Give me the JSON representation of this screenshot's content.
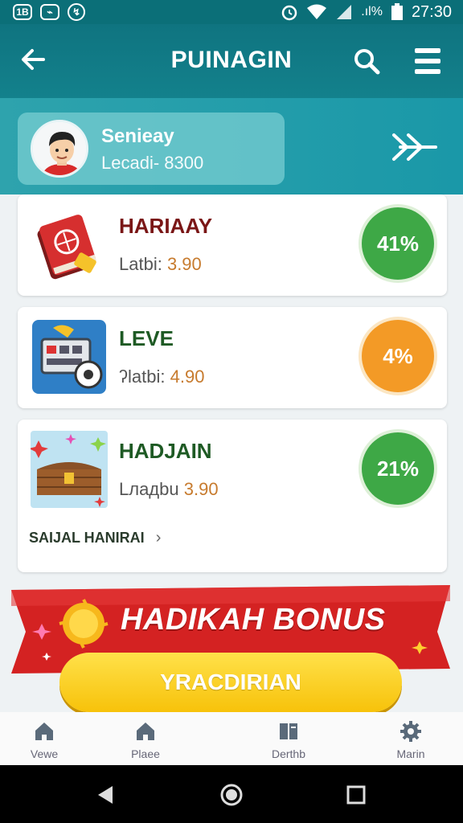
{
  "status_bar": {
    "left_icons": [
      "1B",
      "gallery-icon",
      "messenger-icon"
    ],
    "right_icons": [
      "alarm-icon",
      "wifi-icon",
      "signal-icon",
      "signal-percent-icon",
      "battery-icon"
    ],
    "time": "27:30"
  },
  "app_bar": {
    "title": "PUINAGIN",
    "back_icon": "arrow-left-icon",
    "search_icon": "search-icon",
    "menu_icon": "menu-icon"
  },
  "profile": {
    "name": "Senieay",
    "subtitle": "Lecadi- 8300"
  },
  "cards": [
    {
      "title": "HARIAAY",
      "label": "Latbi:",
      "value": "3.90",
      "badge": "41%",
      "badge_color": "#3ea846",
      "title_color": "#7a1616",
      "icon": "book-icon"
    },
    {
      "title": "LEVE",
      "label": "ʔlatbi:",
      "value": "4.90",
      "badge": "4%",
      "badge_color": "#f39a26",
      "title_color": "#1e5a24",
      "icon": "machine-icon"
    },
    {
      "title": "HADJAIN",
      "label": "Lладbu",
      "value": "3.90",
      "badge": "21%",
      "badge_color": "#3ea846",
      "title_color": "#1e5a24",
      "icon": "treasure-chest-icon"
    }
  ],
  "more_link": "SAIJAL HANIRAI",
  "bonus": {
    "title": "HADIKAH BONUS",
    "cta": "YRACDIRIAN"
  },
  "bottom_nav": [
    {
      "label": "Vewe",
      "icon": "home-icon"
    },
    {
      "label": "Plaee",
      "icon": "home-icon"
    },
    {
      "label": "Derthb",
      "icon": "book-icon"
    },
    {
      "label": "Marin",
      "icon": "gear-icon"
    }
  ],
  "colors": {
    "primary": "#0f7480",
    "accent_red": "#d42222",
    "cta_yellow": "#f7c20a"
  }
}
